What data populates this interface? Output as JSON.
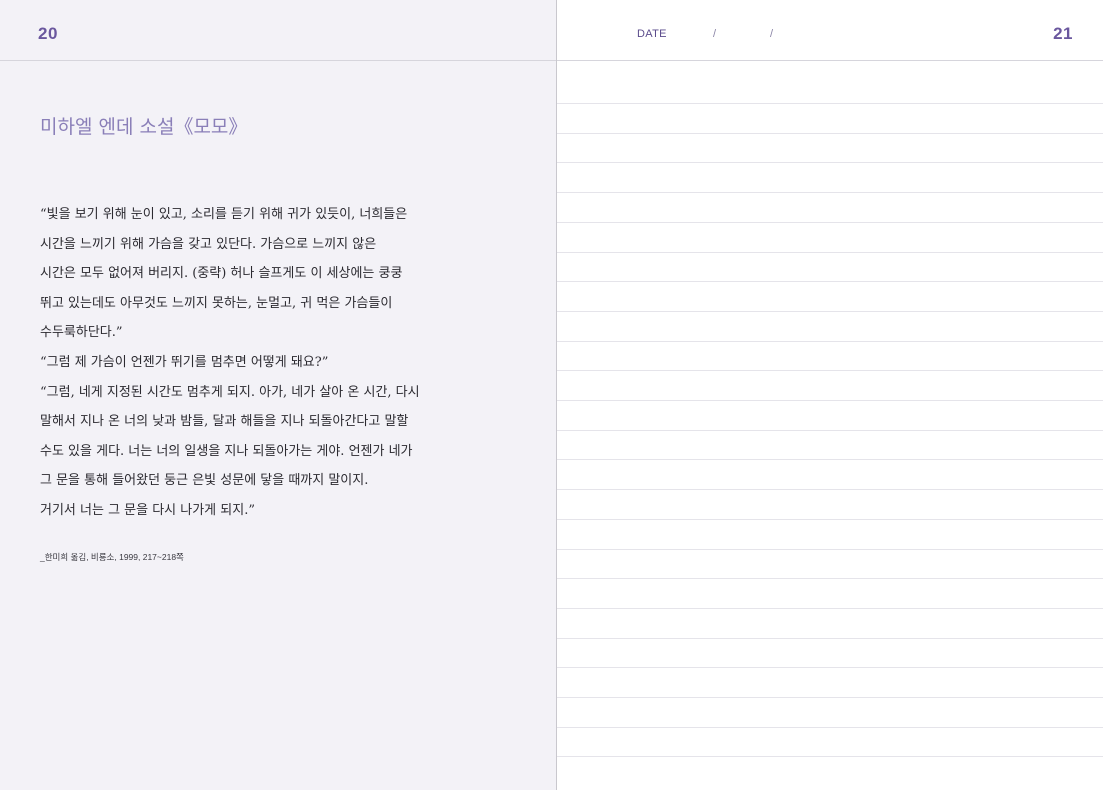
{
  "left_page": {
    "page_number": "20",
    "title": "미하엘 엔데 소설《모모》",
    "quote_lines": [
      "“빛을 보기 위해 눈이 있고, 소리를 듣기 위해 귀가 있듯이, 너희들은",
      "시간을 느끼기 위해 가슴을 갖고 있단다. 가슴으로 느끼지 않은",
      "시간은 모두 없어져 버리지. (중략) 허나 슬프게도 이 세상에는 쿵쿵",
      "뛰고 있는데도 아무것도 느끼지 못하는, 눈멀고, 귀 먹은 가슴들이",
      "수두룩하단다.”",
      "“그럼 제 가슴이 언젠가 뛰기를 멈추면 어떻게 돼요?”",
      "“그럼, 네게 지정된 시간도 멈추게 되지. 아가, 네가 살아 온 시간, 다시",
      "말해서 지나 온 너의 낮과 밤들, 달과 해들을 지나 되돌아간다고 말할",
      "수도 있을 게다. 너는 너의 일생을 지나 되돌아가는 게야. 언젠가 네가",
      "그 문을 통해 들어왔던 둥근 은빛 성문에 닿을 때까지 말이지.",
      "거기서 너는 그 문을 다시 나가게 되지.”"
    ],
    "citation": "_한미희 옮김, 비룡소, 1999, 217~218쪽"
  },
  "right_page": {
    "page_number": "21",
    "date_label": "DATE",
    "date_separators": [
      "/",
      "/"
    ],
    "ruled_line_count": 24
  },
  "colors": {
    "accent": "#6a579e",
    "title": "#8a7fb8",
    "left_page_bg": "#f3f2f7",
    "ruled_line": "#e5e4ea"
  }
}
